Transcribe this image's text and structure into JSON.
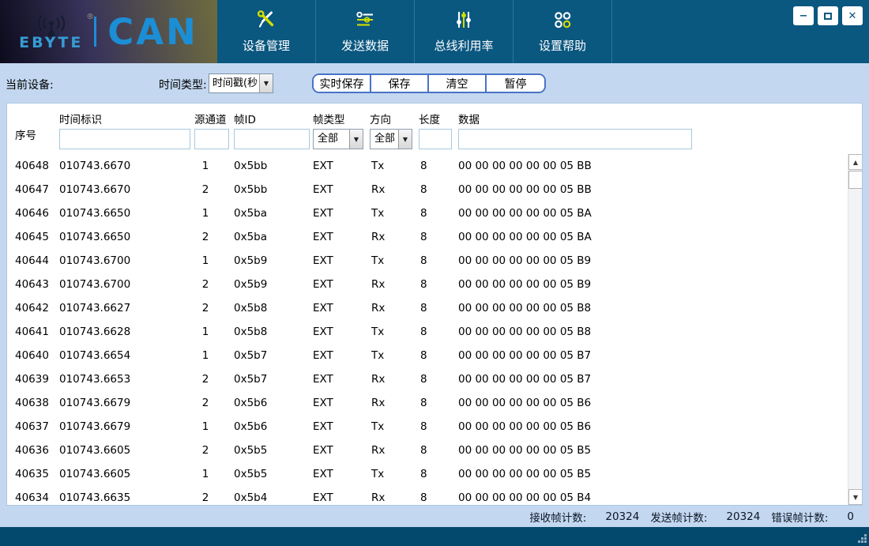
{
  "brand": {
    "name": "EBYTE",
    "trademark": "®",
    "product": "CAN"
  },
  "nav": [
    {
      "label": "设备管理"
    },
    {
      "label": "发送数据"
    },
    {
      "label": "总线利用率"
    },
    {
      "label": "设置帮助"
    }
  ],
  "window_controls": {
    "minimize": "−",
    "close": "✕"
  },
  "toolbar": {
    "current_device_label": "当前设备:",
    "time_type_label": "时间类型:",
    "time_type_value": "时间戳(秒",
    "dropdown_arrow": "▼",
    "buttons": {
      "realtime_save": "实时保存",
      "save": "保存",
      "clear": "清空",
      "pause": "暂停"
    }
  },
  "table": {
    "columns": {
      "seq": "序号",
      "time": "时间标识",
      "channel": "源通道",
      "frame_id": "帧ID",
      "frame_type": "帧类型",
      "direction": "方向",
      "length": "长度",
      "data": "数据"
    },
    "filters": {
      "frame_type_value": "全部",
      "direction_value": "全部",
      "dropdown_arrow": "▼"
    },
    "rows": [
      {
        "seq": "40648",
        "time": "010743.6670",
        "channel": "1",
        "frame_id": "0x5bb",
        "frame_type": "EXT",
        "direction": "Tx",
        "length": "8",
        "data": "00 00 00 00 00 00 05 BB"
      },
      {
        "seq": "40647",
        "time": "010743.6670",
        "channel": "2",
        "frame_id": "0x5bb",
        "frame_type": "EXT",
        "direction": "Rx",
        "length": "8",
        "data": "00 00 00 00 00 00 05 BB"
      },
      {
        "seq": "40646",
        "time": "010743.6650",
        "channel": "1",
        "frame_id": "0x5ba",
        "frame_type": "EXT",
        "direction": "Tx",
        "length": "8",
        "data": "00 00 00 00 00 00 05 BA"
      },
      {
        "seq": "40645",
        "time": "010743.6650",
        "channel": "2",
        "frame_id": "0x5ba",
        "frame_type": "EXT",
        "direction": "Rx",
        "length": "8",
        "data": "00 00 00 00 00 00 05 BA"
      },
      {
        "seq": "40644",
        "time": "010743.6700",
        "channel": "1",
        "frame_id": "0x5b9",
        "frame_type": "EXT",
        "direction": "Tx",
        "length": "8",
        "data": "00 00 00 00 00 00 05 B9"
      },
      {
        "seq": "40643",
        "time": "010743.6700",
        "channel": "2",
        "frame_id": "0x5b9",
        "frame_type": "EXT",
        "direction": "Rx",
        "length": "8",
        "data": "00 00 00 00 00 00 05 B9"
      },
      {
        "seq": "40642",
        "time": "010743.6627",
        "channel": "2",
        "frame_id": "0x5b8",
        "frame_type": "EXT",
        "direction": "Rx",
        "length": "8",
        "data": "00 00 00 00 00 00 05 B8"
      },
      {
        "seq": "40641",
        "time": "010743.6628",
        "channel": "1",
        "frame_id": "0x5b8",
        "frame_type": "EXT",
        "direction": "Tx",
        "length": "8",
        "data": "00 00 00 00 00 00 05 B8"
      },
      {
        "seq": "40640",
        "time": "010743.6654",
        "channel": "1",
        "frame_id": "0x5b7",
        "frame_type": "EXT",
        "direction": "Tx",
        "length": "8",
        "data": "00 00 00 00 00 00 05 B7"
      },
      {
        "seq": "40639",
        "time": "010743.6653",
        "channel": "2",
        "frame_id": "0x5b7",
        "frame_type": "EXT",
        "direction": "Rx",
        "length": "8",
        "data": "00 00 00 00 00 00 05 B7"
      },
      {
        "seq": "40638",
        "time": "010743.6679",
        "channel": "2",
        "frame_id": "0x5b6",
        "frame_type": "EXT",
        "direction": "Rx",
        "length": "8",
        "data": "00 00 00 00 00 00 05 B6"
      },
      {
        "seq": "40637",
        "time": "010743.6679",
        "channel": "1",
        "frame_id": "0x5b6",
        "frame_type": "EXT",
        "direction": "Tx",
        "length": "8",
        "data": "00 00 00 00 00 00 05 B6"
      },
      {
        "seq": "40636",
        "time": "010743.6605",
        "channel": "2",
        "frame_id": "0x5b5",
        "frame_type": "EXT",
        "direction": "Rx",
        "length": "8",
        "data": "00 00 00 00 00 00 05 B5"
      },
      {
        "seq": "40635",
        "time": "010743.6605",
        "channel": "1",
        "frame_id": "0x5b5",
        "frame_type": "EXT",
        "direction": "Tx",
        "length": "8",
        "data": "00 00 00 00 00 00 05 B5"
      },
      {
        "seq": "40634",
        "time": "010743.6635",
        "channel": "2",
        "frame_id": "0x5b4",
        "frame_type": "EXT",
        "direction": "Rx",
        "length": "8",
        "data": "00 00 00 00 00 00 05 B4"
      }
    ]
  },
  "scrollbar": {
    "up_arrow": "▲",
    "down_arrow": "▼"
  },
  "statusbar": {
    "received_label": "接收帧计数:",
    "received_value": "20324",
    "sent_label": "发送帧计数:",
    "sent_value": "20324",
    "error_label": "错误帧计数:",
    "error_value": "0"
  },
  "colors": {
    "titlebar_blue": "#0a5780",
    "panel_light_blue": "#c3d8f0",
    "brand_blue": "#1b8ed6",
    "icon_yellow": "#d3dc00",
    "button_border_blue": "#4a72c8",
    "footer_blue": "#03486d"
  }
}
